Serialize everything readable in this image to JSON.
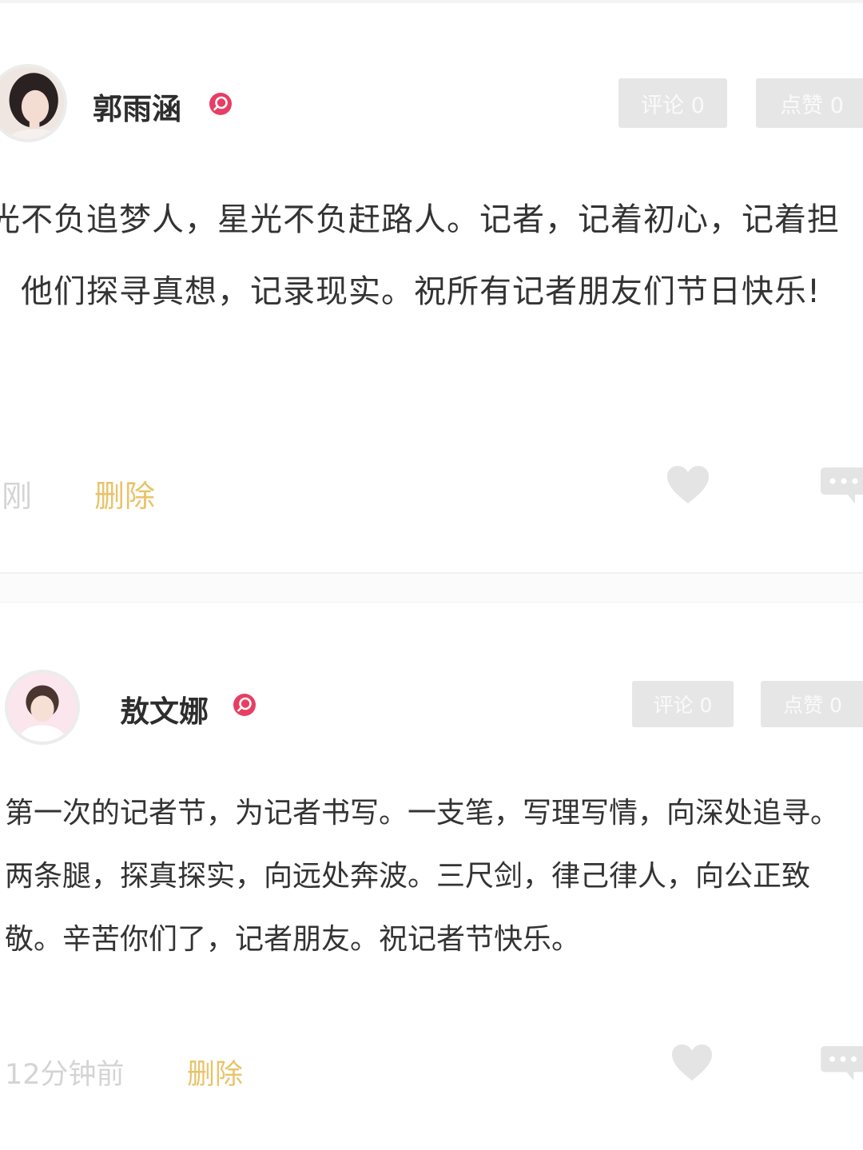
{
  "posts": [
    {
      "author": "郭雨涵",
      "comment_button": "评论 0",
      "like_button": "点赞 0",
      "text": "时光不负追梦人，星光不负赶路人。记者，记着初心，记着担当。他们探寻真想，记录现实。祝所有记者朋友们节日快乐!",
      "time": "刚刚",
      "delete_label": "删除"
    },
    {
      "author": "敖文娜",
      "comment_button": "评论 0",
      "like_button": "点赞 0",
      "text": "第一次的记者节，为记者书写。一支笔，写理写情，向深处追寻。两条腿，探真探实，向远处奔波。三尺剑，律己律人，向公正致敬。辛苦你们了，记者朋友。祝记者节快乐。",
      "time": "12分钟前",
      "delete_label": "删除"
    }
  ],
  "icons": {
    "verified": "verified-badge-icon",
    "like": "heart-icon",
    "comment": "comment-bubble-icon"
  },
  "colors": {
    "badge": "#e83e63",
    "delete": "#e9c36a",
    "pill_bg": "#e6e6e6",
    "muted": "#d4d4d4"
  }
}
